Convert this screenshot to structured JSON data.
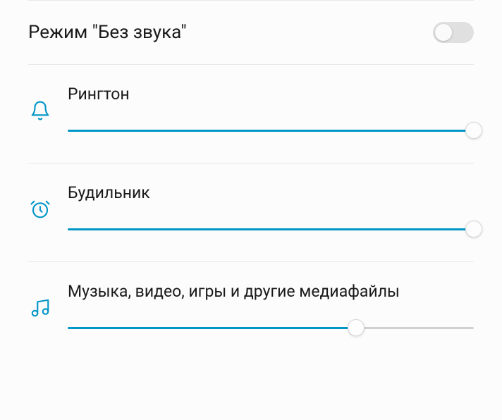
{
  "accent_color": "#0096c7",
  "mute_mode": {
    "label": "Режим \"Без звука\"",
    "enabled": false
  },
  "sliders": {
    "ringtone": {
      "label": "Рингтон",
      "value": 100
    },
    "alarm": {
      "label": "Будильник",
      "value": 100
    },
    "media": {
      "label": "Музыка, видео, игры и другие медиафайлы",
      "value": 71
    }
  }
}
